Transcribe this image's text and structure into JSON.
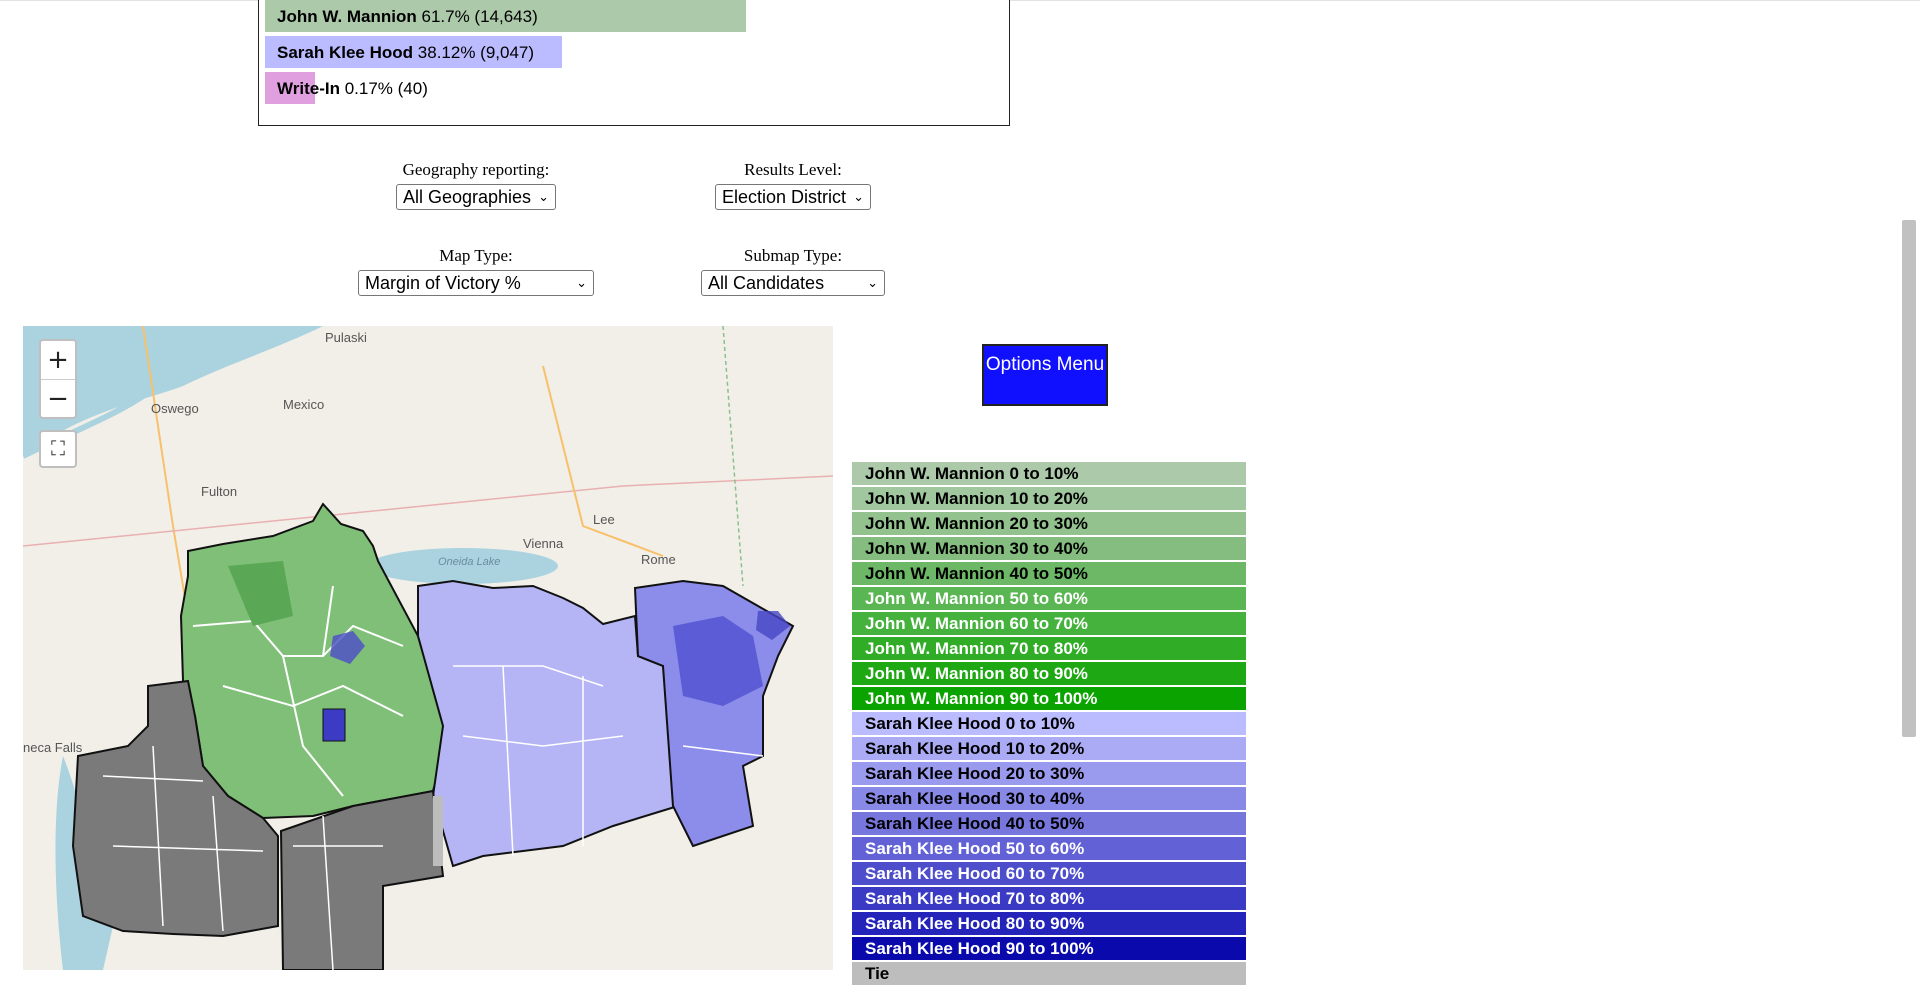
{
  "results": [
    {
      "name": "John W. Mannion",
      "stats": "61.7% (14,643)",
      "bar_fraction": 0.617,
      "color": "#acc9aa"
    },
    {
      "name": "Sarah Klee Hood",
      "stats": "38.12% (9,047)",
      "bar_fraction": 0.3812,
      "color": "#bbbbff"
    },
    {
      "name": "Write-In",
      "stats": "0.17% (40)",
      "bar_fraction": 0.0017,
      "color": "#e0a0e0"
    }
  ],
  "controls": {
    "geography_label": "Geography reporting:",
    "geography_value": "All Geographies",
    "results_level_label": "Results Level:",
    "results_level_value": "Election District",
    "map_type_label": "Map Type:",
    "map_type_value": "Margin of Victory %",
    "submap_type_label": "Submap Type:",
    "submap_type_value": "All Candidates"
  },
  "map": {
    "zoom_in": "+",
    "zoom_out": "−",
    "fullscreen": "⛶",
    "labels": [
      "Pulaski",
      "Oswego",
      "Mexico",
      "Fulton",
      "Lee",
      "Vienna",
      "Oneida Lake",
      "Rome",
      "neca Falls"
    ]
  },
  "options_button": "Options Menu",
  "legend": [
    {
      "label": "John W. Mannion 0 to 10%",
      "color": "#acc9aa",
      "text_color": "#000000"
    },
    {
      "label": "John W. Mannion 10 to 20%",
      "color": "#a1c79e",
      "text_color": "#000000"
    },
    {
      "label": "John W. Mannion 20 to 30%",
      "color": "#93c28f",
      "text_color": "#000000"
    },
    {
      "label": "John W. Mannion 30 to 40%",
      "color": "#84bd7f",
      "text_color": "#000000"
    },
    {
      "label": "John W. Mannion 40 to 50%",
      "color": "#6cb866",
      "text_color": "#000000"
    },
    {
      "label": "John W. Mannion 50 to 60%",
      "color": "#5ab553",
      "text_color": "#ffffff"
    },
    {
      "label": "John W. Mannion 60 to 70%",
      "color": "#45b23d",
      "text_color": "#ffffff"
    },
    {
      "label": "John W. Mannion 70 to 80%",
      "color": "#30ac27",
      "text_color": "#ffffff"
    },
    {
      "label": "John W. Mannion 80 to 90%",
      "color": "#1ea814",
      "text_color": "#ffffff"
    },
    {
      "label": "John W. Mannion 90 to 100%",
      "color": "#0aa300",
      "text_color": "#ffffff"
    },
    {
      "label": "Sarah Klee Hood 0 to 10%",
      "color": "#bbbbff",
      "text_color": "#000000"
    },
    {
      "label": "Sarah Klee Hood 10 to 20%",
      "color": "#aaaaf5",
      "text_color": "#000000"
    },
    {
      "label": "Sarah Klee Hood 20 to 30%",
      "color": "#9a9aee",
      "text_color": "#000000"
    },
    {
      "label": "Sarah Klee Hood 30 to 40%",
      "color": "#8888e6",
      "text_color": "#000000"
    },
    {
      "label": "Sarah Klee Hood 40 to 50%",
      "color": "#7676dd",
      "text_color": "#000000"
    },
    {
      "label": "Sarah Klee Hood 50 to 60%",
      "color": "#6262d6",
      "text_color": "#ffffff"
    },
    {
      "label": "Sarah Klee Hood 60 to 70%",
      "color": "#4e4ecd",
      "text_color": "#ffffff"
    },
    {
      "label": "Sarah Klee Hood 70 to 80%",
      "color": "#3a3ac4",
      "text_color": "#ffffff"
    },
    {
      "label": "Sarah Klee Hood 80 to 90%",
      "color": "#2424bb",
      "text_color": "#ffffff"
    },
    {
      "label": "Sarah Klee Hood 90 to 100%",
      "color": "#0a0aac",
      "text_color": "#ffffff"
    },
    {
      "label": "Tie",
      "color": "#bdbdbd",
      "text_color": "#000000"
    }
  ]
}
